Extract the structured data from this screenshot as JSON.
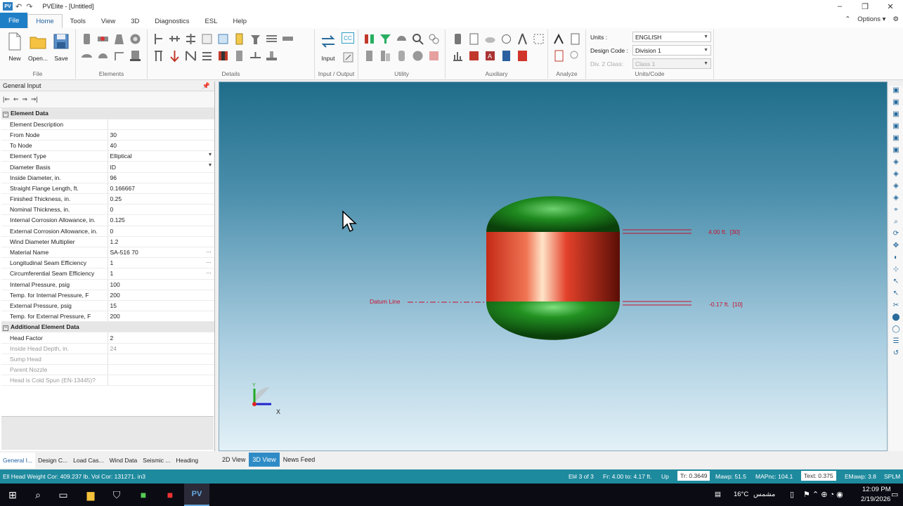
{
  "app": {
    "logo": "PV",
    "title": "PVElite - [Untitled]"
  },
  "ribbon_tabs": [
    "File",
    "Home",
    "Tools",
    "View",
    "3D",
    "Diagnostics",
    "ESL",
    "Help"
  ],
  "options_label": "Options",
  "ribbon": {
    "file_group": {
      "label": "File",
      "new": "New",
      "open": "Open...",
      "save": "Save"
    },
    "elements_label": "Elements",
    "details_label": "Details",
    "io_group": {
      "label": "Input / Output",
      "input": "Input",
      "cc_badge": "CC"
    },
    "utility_label": "Utility",
    "auxiliary_label": "Auxiliary",
    "analyze_label": "Analyze",
    "units_code": {
      "label": "Units/Code",
      "units_label": "Units :",
      "units_value": "ENGLISH",
      "design_code_label": "Design Code :",
      "design_code_value": "Division 1",
      "div2_label": "Div. 2 Class:",
      "div2_value": "Class 1"
    }
  },
  "left_panel": {
    "title": "General Input",
    "sections": [
      {
        "name": "Element Data",
        "rows": [
          {
            "k": "Element Description",
            "v": ""
          },
          {
            "k": "From Node",
            "v": "30"
          },
          {
            "k": "To Node",
            "v": "40"
          },
          {
            "k": "Element Type",
            "v": "Elliptical",
            "dropdown": true
          },
          {
            "k": "Diameter Basis",
            "v": "ID",
            "dropdown": true
          },
          {
            "k": "Inside Diameter, in.",
            "v": "96"
          },
          {
            "k": "Straight Flange Length, ft.",
            "v": "0.166667"
          },
          {
            "k": "Finished Thickness, in.",
            "v": "0.25"
          },
          {
            "k": "Nominal Thickness, in.",
            "v": "0"
          },
          {
            "k": "Internal Corrosion Allowance, in.",
            "v": "0.125"
          },
          {
            "k": "External Corrosion Allowance, in.",
            "v": "0"
          },
          {
            "k": "Wind Diameter Multiplier",
            "v": "1.2"
          },
          {
            "k": "Material Name",
            "v": "SA-516 70",
            "ellipsis": true
          },
          {
            "k": "Longitudinal Seam Efficiency",
            "v": "1",
            "ellipsis": true
          },
          {
            "k": "Circumferential Seam Efficiency",
            "v": "1",
            "ellipsis": true
          },
          {
            "k": "Internal Pressure, psig",
            "v": "100"
          },
          {
            "k": "Temp. for Internal Pressure, F",
            "v": "200"
          },
          {
            "k": "External Pressure, psig",
            "v": "15"
          },
          {
            "k": "Temp. for External Pressure, F",
            "v": "200"
          }
        ]
      },
      {
        "name": "Additional Element Data",
        "rows": [
          {
            "k": "Head Factor",
            "v": "2"
          },
          {
            "k": "Inside Head Depth, in.",
            "v": "24",
            "grey": true
          },
          {
            "k": "Sump Head",
            "v": "",
            "grey": true
          },
          {
            "k": "Parent Nozzle",
            "v": "",
            "grey": true
          },
          {
            "k": "Head is Cold Spun (EN-13445)?",
            "v": "",
            "grey": true
          }
        ]
      }
    ],
    "bottom_tabs": [
      "General I...",
      "Design C...",
      "Load Cas...",
      "Wind Data",
      "Seismic ...",
      "Heading"
    ]
  },
  "viewport": {
    "datum_label": "Datum Line",
    "dim_top": "4.00 ft.  [30]",
    "dim_bottom": "-0.17 ft.  [10]",
    "axis_x": "X",
    "axis_y": "Y"
  },
  "view_tabs": [
    "2D View",
    "3D View",
    "News Feed"
  ],
  "status": {
    "weight": "Ell Head Weight Cor: 409.237 lb.  Vol Cor: 131271. in3",
    "element": "El# 3 of 3",
    "from_to": "Fr: 4.00 to: 4.17 ft.",
    "up": "Up",
    "tr": "Tr: 0.3649",
    "mawp": "Mawp: 51.5",
    "mapnc": "MAPnc: 104.1",
    "text": "Text: 0.375",
    "emawp": "EMawp: 3.8",
    "splm": "SPLM"
  },
  "taskbar": {
    "temp": "16°C",
    "weather": "مشمس",
    "time": "12:09 PM",
    "date": "2/19/2026"
  },
  "colors": {
    "accent": "#1f7fc6",
    "status_bar": "#1e8a9e",
    "head_green": "#1c7a1c",
    "shell_red": "#d63a22",
    "dim_red": "#c8102e"
  }
}
